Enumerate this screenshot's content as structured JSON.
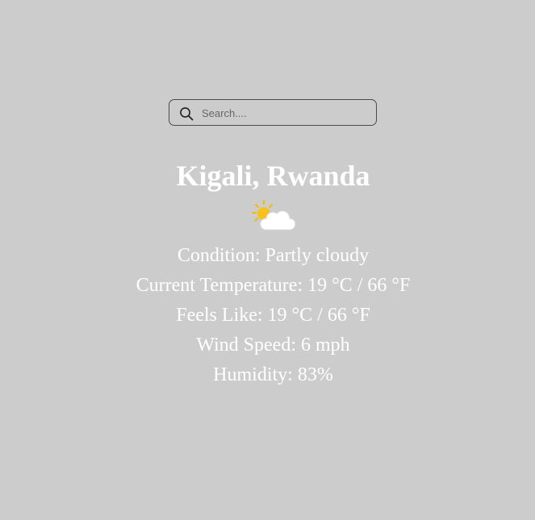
{
  "search": {
    "placeholder": "Search....",
    "value": "",
    "icon": "search-icon"
  },
  "weather": {
    "location": "Kigali, Rwanda",
    "icon": "partly-cloudy-icon",
    "condition_text": "Condition: Partly cloudy",
    "temperature_text": "Current Temperature: 19 °C / 66 °F",
    "feels_like_text": "Feels Like: 19 °C / 66 °F",
    "wind_text": "Wind Speed: 6 mph",
    "humidity_text": "Humidity: 83%"
  },
  "colors": {
    "background": "#cccccc",
    "text": "#ffffff",
    "search_border": "#4a4a4a"
  }
}
